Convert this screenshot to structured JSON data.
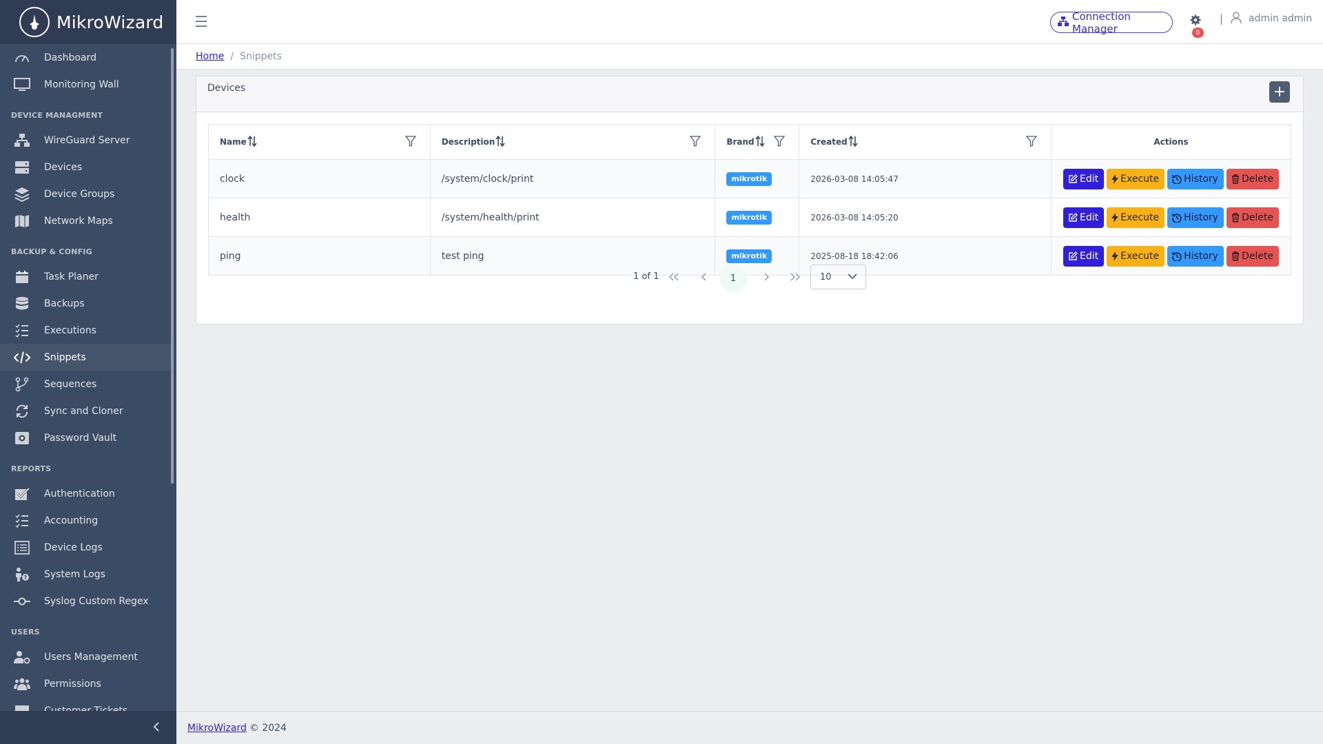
{
  "app": {
    "name": "MikroWizard"
  },
  "sidebar": {
    "items": [
      {
        "label": "Dashboard",
        "icon": "speedometer-icon"
      },
      {
        "label": "Monitoring Wall",
        "icon": "monitor-icon"
      }
    ],
    "sections": [
      {
        "title": "DEVICE MANAGMENT",
        "items": [
          {
            "label": "WireGuard Server",
            "icon": "network-icon"
          },
          {
            "label": "Devices",
            "icon": "storage-icon"
          },
          {
            "label": "Device Groups",
            "icon": "layers-icon"
          },
          {
            "label": "Network Maps",
            "icon": "map-icon"
          }
        ]
      },
      {
        "title": "BACKUP & CONFIG",
        "items": [
          {
            "label": "Task Planer",
            "icon": "calendar-icon"
          },
          {
            "label": "Backups",
            "icon": "database-icon"
          },
          {
            "label": "Executions",
            "icon": "list-check-icon"
          },
          {
            "label": "Snippets",
            "icon": "code-icon",
            "active": true
          },
          {
            "label": "Sequences",
            "icon": "branch-icon"
          },
          {
            "label": "Sync and Cloner",
            "icon": "sync-icon"
          },
          {
            "label": "Password Vault",
            "icon": "vault-icon"
          }
        ]
      },
      {
        "title": "REPORTS",
        "items": [
          {
            "label": "Authentication",
            "icon": "check-square-icon"
          },
          {
            "label": "Accounting",
            "icon": "list-check-icon"
          },
          {
            "label": "Device Logs",
            "icon": "log-list-icon"
          },
          {
            "label": "System Logs",
            "icon": "person-question-icon"
          },
          {
            "label": "Syslog Custom Regex",
            "icon": "commit-icon"
          }
        ]
      },
      {
        "title": "USERS",
        "items": [
          {
            "label": "Users Management",
            "icon": "user-gear-icon"
          },
          {
            "label": "Permissions",
            "icon": "users-icon"
          },
          {
            "label": "Customer Tickets",
            "icon": "ticket-icon"
          }
        ]
      }
    ]
  },
  "header": {
    "connection_manager": "Connection Manager",
    "notification_count": "0",
    "separator": "|",
    "user": "admin admin"
  },
  "breadcrumb": {
    "home": "Home",
    "separator": "/",
    "current": "Snippets"
  },
  "card": {
    "title": "Devices",
    "add_label": "+"
  },
  "table": {
    "columns": [
      "Name",
      "Description",
      "Brand",
      "Created",
      "Actions"
    ],
    "rows": [
      {
        "name": "clock",
        "description": "/system/clock/print",
        "brand": "mikrotik",
        "created": "2026-03-08 14:05:47"
      },
      {
        "name": "health",
        "description": "/system/health/print",
        "brand": "mikrotik",
        "created": "2026-03-08 14:05:20"
      },
      {
        "name": "ping",
        "description": "test ping",
        "brand": "mikrotik",
        "created": "2025-08-18 18:42:06"
      }
    ],
    "actions": {
      "edit": "Edit",
      "execute": "Execute",
      "history": "History",
      "delete": "Delete"
    }
  },
  "pagination": {
    "summary": "1 of 1",
    "current_page": "1",
    "page_size": "10"
  },
  "footer": {
    "link": "MikroWizard",
    "text": "© 2024"
  },
  "colors": {
    "sidebar": "#3c4b64",
    "primary": "#321fdb",
    "warning": "#f9b115",
    "info": "#3399ff",
    "danger": "#e55353"
  }
}
